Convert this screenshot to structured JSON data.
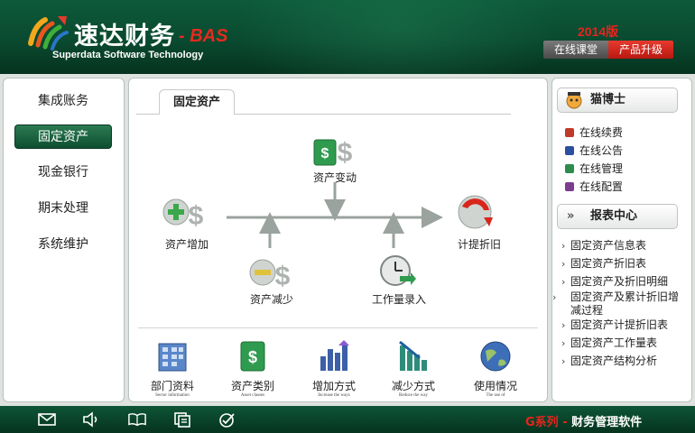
{
  "header": {
    "brand_title": "速达财务",
    "brand_suffix": "- BAS",
    "brand_subtitle": "Superdata Software Technology",
    "version": "2014版",
    "online_class_label": "在线课堂",
    "upgrade_label": "产品升级"
  },
  "left_nav": {
    "items": [
      {
        "label": "集成账务"
      },
      {
        "label": "固定资产",
        "active": true
      },
      {
        "label": "现金银行"
      },
      {
        "label": "期末处理"
      },
      {
        "label": "系统维护"
      }
    ]
  },
  "main": {
    "tab_label": "固定资产",
    "flow": {
      "asset_change": "资产变动",
      "asset_add": "资产增加",
      "asset_reduce": "资产减少",
      "workload_entry": "工作量录入",
      "depreciation": "计提折旧"
    },
    "bottom_items": [
      {
        "label": "部门资料",
        "sub": "Sector information",
        "icon": "building-icon"
      },
      {
        "label": "资产类别",
        "sub": "Asset classes",
        "icon": "money-stack-icon"
      },
      {
        "label": "增加方式",
        "sub": "Increase the ways",
        "icon": "bar-up-icon"
      },
      {
        "label": "减少方式",
        "sub": "Reduce the way",
        "icon": "bar-down-icon"
      },
      {
        "label": "使用情况",
        "sub": "The use of",
        "icon": "globe-icon"
      }
    ]
  },
  "right_panel": {
    "assistant_title": "猫博士",
    "services": [
      {
        "label": "在线续费",
        "color": "#c0392b"
      },
      {
        "label": "在线公告",
        "color": "#2c4f9e"
      },
      {
        "label": "在线管理",
        "color": "#2d8b4e"
      },
      {
        "label": "在线配置",
        "color": "#7b3d8f"
      }
    ],
    "reports_title": "报表中心",
    "reports_chevron": "»",
    "reports": [
      "固定资产信息表",
      "固定资产折旧表",
      "固定资产及折旧明细",
      "固定资产及累计折旧增减过程",
      "固定资产计提折旧表",
      "固定资产工作量表",
      "固定资产结构分析"
    ]
  },
  "footer": {
    "brand_series": "G系列",
    "brand_dash": " - ",
    "brand_name": "财务管理软件"
  }
}
